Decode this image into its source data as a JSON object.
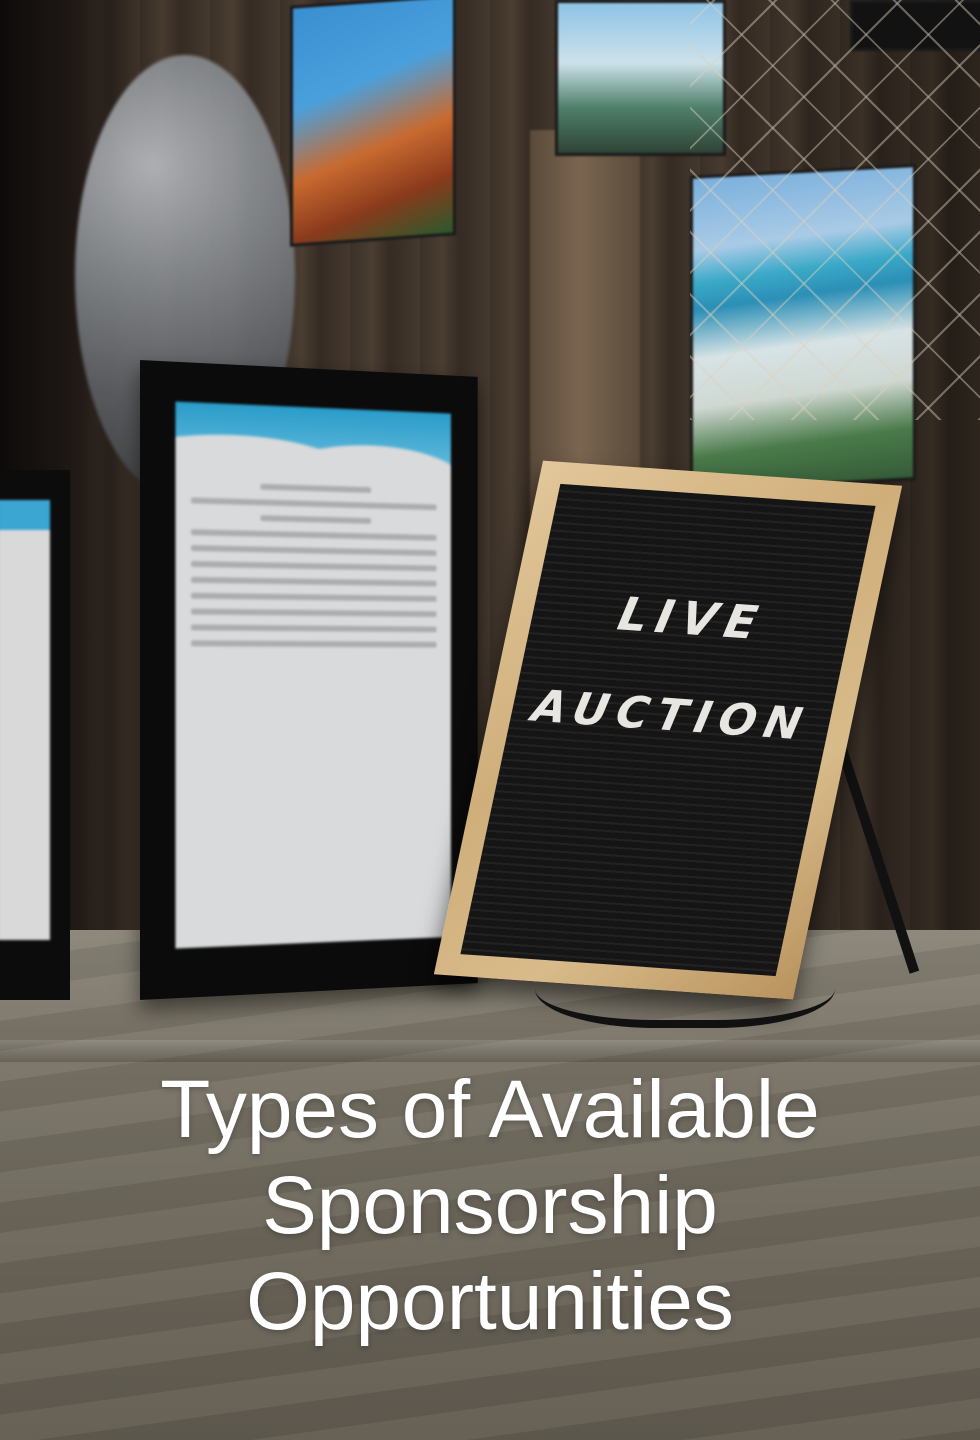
{
  "title": {
    "line1": "Types of Available",
    "line2": "Sponsorship",
    "line3": "Opportunities"
  },
  "letter_board": {
    "line1": "LIVE",
    "line2": "AUCTION"
  },
  "colors": {
    "title_text": "#ffffff",
    "board_felt": "#151515",
    "board_wood": "#d8bb8a",
    "card_wave": "#2a9cc9"
  }
}
